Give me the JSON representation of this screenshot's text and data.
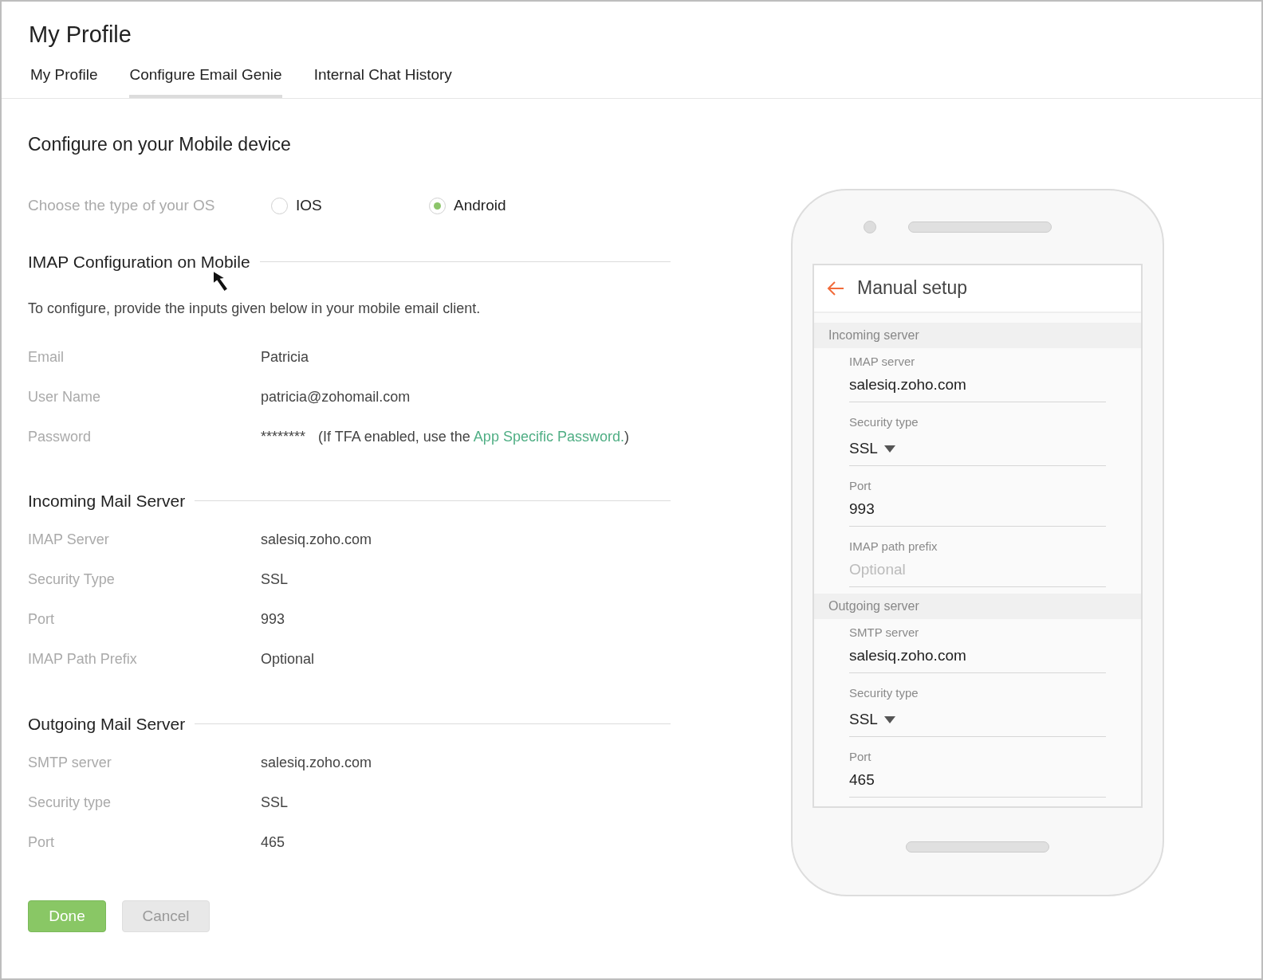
{
  "page_title": "My Profile",
  "tabs": [
    {
      "label": "My Profile",
      "selected": false
    },
    {
      "label": "Configure Email Genie",
      "selected": true
    },
    {
      "label": "Internal Chat History",
      "selected": false
    }
  ],
  "heading": "Configure on your Mobile device",
  "os_choice": {
    "label": "Choose the type of your OS",
    "options": [
      {
        "label": "IOS",
        "selected": false
      },
      {
        "label": "Android",
        "selected": true
      }
    ]
  },
  "sections": [
    {
      "title": "IMAP Configuration on Mobile",
      "intro": "To configure, provide the inputs given below in your mobile email client.",
      "rows": [
        {
          "label": "Email",
          "value": "Patricia"
        },
        {
          "label": "User Name",
          "value": "patricia@zohomail.com"
        },
        {
          "label": "Password",
          "value": "********",
          "note": "(If TFA enabled, use the ",
          "link": "App Specific Password.",
          "note_end": ")"
        }
      ]
    },
    {
      "title": "Incoming Mail Server",
      "rows": [
        {
          "label": "IMAP Server",
          "value": "salesiq.zoho.com"
        },
        {
          "label": "Security Type",
          "value": "SSL"
        },
        {
          "label": "Port",
          "value": "993"
        },
        {
          "label": "IMAP Path Prefix",
          "value": "Optional"
        }
      ]
    },
    {
      "title": "Outgoing Mail Server",
      "rows": [
        {
          "label": "SMTP server",
          "value": "salesiq.zoho.com"
        },
        {
          "label": "Security type",
          "value": "SSL"
        },
        {
          "label": "Port",
          "value": "465"
        }
      ]
    }
  ],
  "buttons": [
    {
      "label": "Done",
      "kind": "primary"
    },
    {
      "label": "Cancel",
      "kind": "secondary"
    }
  ],
  "phone": {
    "title": "Manual setup",
    "groups": [
      {
        "title": "Incoming server",
        "fields": [
          {
            "kind": "text",
            "label": "IMAP server",
            "value": "salesiq.zoho.com"
          },
          {
            "kind": "select",
            "label": "Security type",
            "value": "SSL"
          },
          {
            "kind": "text",
            "label": "Port",
            "value": "993"
          },
          {
            "kind": "text",
            "label": "IMAP path prefix",
            "placeholder": "Optional"
          }
        ]
      },
      {
        "title": "Outgoing server",
        "fields": [
          {
            "kind": "text",
            "label": "SMTP server",
            "value": "salesiq.zoho.com"
          },
          {
            "kind": "select",
            "label": "Security type",
            "value": "SSL"
          },
          {
            "kind": "text",
            "label": "Port",
            "value": "465"
          }
        ]
      }
    ]
  }
}
